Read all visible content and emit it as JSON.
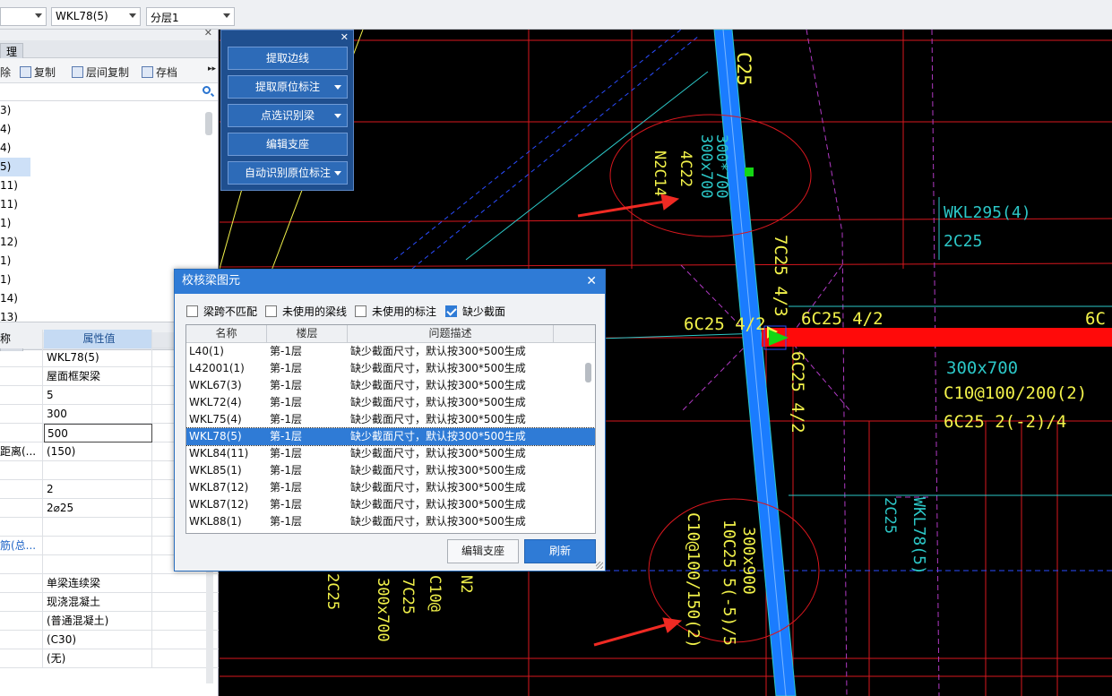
{
  "topbar": {
    "combo1": "",
    "combo2": "WKL78(5)",
    "combo3": "分层1"
  },
  "left_panel": {
    "tab_label": "理",
    "toolbar": {
      "delete": "除",
      "copy": "复制",
      "floor_copy": "层间复制",
      "save": "存档",
      "more": "▸▸"
    },
    "tree_items": [
      "3)",
      "4)",
      "4)",
      "5)",
      "11)",
      "11)",
      "1)",
      "12)",
      "1)",
      "1)",
      "14)",
      "13)"
    ],
    "selected_index": 3,
    "props_tab_label": "理",
    "props_header": {
      "name": "称",
      "value": "属性值"
    },
    "props": [
      {
        "k": "",
        "v": "WKL78(5)"
      },
      {
        "k": "",
        "v": "屋面框架梁"
      },
      {
        "k": "",
        "v": "5"
      },
      {
        "k": "",
        "v": "300"
      },
      {
        "k": "",
        "v": "500",
        "edit": true
      },
      {
        "k": "距离(...",
        "v": "(150)"
      },
      {
        "k": "",
        "v": ""
      },
      {
        "k": "",
        "v": "2"
      },
      {
        "k": "",
        "v": "2⌀25"
      },
      {
        "k": "",
        "v": ""
      },
      {
        "k": "筋(总...",
        "v": "",
        "blue": true
      },
      {
        "k": "",
        "v": ""
      },
      {
        "k": "",
        "v": "单梁连续梁"
      },
      {
        "k": "",
        "v": "现浇混凝土"
      },
      {
        "k": "",
        "v": "(普通混凝土)"
      },
      {
        "k": "",
        "v": "(C30)"
      },
      {
        "k": "",
        "v": "(无)"
      }
    ]
  },
  "float_panel": {
    "buttons": [
      {
        "label": "提取边线",
        "dropdown": false
      },
      {
        "label": "提取原位标注",
        "dropdown": true
      },
      {
        "label": "点选识别梁",
        "dropdown": true
      },
      {
        "label": "编辑支座",
        "dropdown": false
      },
      {
        "label": "自动识别原位标注",
        "dropdown": true
      }
    ]
  },
  "dialog": {
    "title": "校核梁图元",
    "checks": [
      {
        "label": "梁跨不匹配",
        "checked": false
      },
      {
        "label": "未使用的梁线",
        "checked": false
      },
      {
        "label": "未使用的标注",
        "checked": false
      },
      {
        "label": "缺少截面",
        "checked": true
      }
    ],
    "columns": [
      "名称",
      "楼层",
      "问题描述"
    ],
    "rows": [
      {
        "name": "L40(1)",
        "floor": "第-1层",
        "desc": "缺少截面尺寸，默认按300*500生成"
      },
      {
        "name": "L42001(1)",
        "floor": "第-1层",
        "desc": "缺少截面尺寸，默认按300*500生成"
      },
      {
        "name": "WKL67(3)",
        "floor": "第-1层",
        "desc": "缺少截面尺寸，默认按300*500生成"
      },
      {
        "name": "WKL72(4)",
        "floor": "第-1层",
        "desc": "缺少截面尺寸，默认按300*500生成"
      },
      {
        "name": "WKL75(4)",
        "floor": "第-1层",
        "desc": "缺少截面尺寸，默认按300*500生成"
      },
      {
        "name": "WKL78(5)",
        "floor": "第-1层",
        "desc": "缺少截面尺寸，默认按300*500生成"
      },
      {
        "name": "WKL84(11)",
        "floor": "第-1层",
        "desc": "缺少截面尺寸，默认按300*500生成"
      },
      {
        "name": "WKL85(1)",
        "floor": "第-1层",
        "desc": "缺少截面尺寸，默认按300*500生成"
      },
      {
        "name": "WKL87(12)",
        "floor": "第-1层",
        "desc": "缺少截面尺寸，默认按300*500生成"
      },
      {
        "name": "WKL87(12)",
        "floor": "第-1层",
        "desc": "缺少截面尺寸，默认按300*500生成"
      },
      {
        "name": "WKL88(1)",
        "floor": "第-1层",
        "desc": "缺少截面尺寸，默认按300*500生成"
      }
    ],
    "selected_row": 5,
    "btn_edit": "编辑支座",
    "btn_refresh": "刷新"
  },
  "cad": {
    "labels": {
      "top_beam": "C25",
      "sec_top": "300*700",
      "sec_top2": "300x700",
      "rebar_a": "4C22",
      "rebar_b": "N2C14",
      "wkl295": "WKL295(4)",
      "c25_2": "2C25",
      "c7c25": "7C25 4/3",
      "c6c25_left": "6C25 4/2",
      "c6c25_right": "6C25 4/2",
      "c6c_edge": "6C",
      "c6c25_down": "6C25 4/2",
      "sec_right": "300x700",
      "stirrup_right": "C10@100/200(2)",
      "rebar_right": "6C25 2(-2)/4",
      "wkl78": "WKL78(5)",
      "c2c25_v": "2C25",
      "sec_bottom": "300x900",
      "rebar_bottom": "10C25 5(-5)/5",
      "stirrup_bottom": "C10@100/150(2)",
      "left_sec": "300x700",
      "left_7c": "7C25",
      "left_c10": "C10@",
      "left_2c": "2C25",
      "left_n": "N2"
    },
    "colors": {
      "beam_blue": "#1a7cff",
      "beam_red": "#ff0a0a",
      "annotation_yellow": "#f2f24a",
      "cyan_text": "#2cc7c7",
      "grid_red": "#d8171e",
      "purple_dash": "#b13ac4",
      "arrow_red": "#ef2a23"
    }
  }
}
